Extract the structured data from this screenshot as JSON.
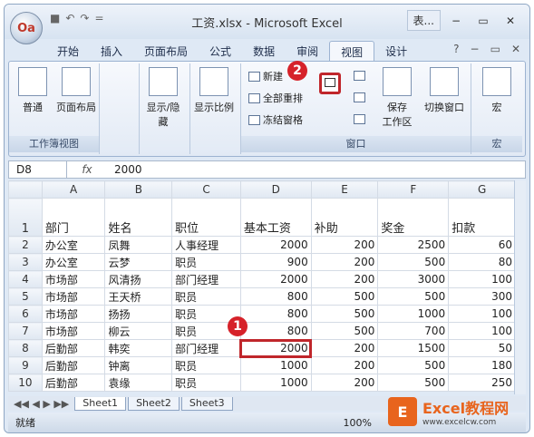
{
  "window": {
    "title": "工资.xlsx - Microsoft Excel",
    "user": "表...",
    "minimize": "−",
    "restore": "▭",
    "close": "✕"
  },
  "office_button": {
    "label": "Oa"
  },
  "quick_access": {
    "save": "■",
    "undo": "↶",
    "redo": "↷",
    "customize": "="
  },
  "tabs": [
    "开始",
    "插入",
    "页面布局",
    "公式",
    "数据",
    "审阅",
    "视图",
    "设计"
  ],
  "active_tab": "视图",
  "tabs_right": {
    "help": "?",
    "minimize": "−",
    "restore": "▭",
    "close": "✕"
  },
  "ribbon": {
    "group_workbook_views": {
      "label": "工作簿视图",
      "normal": "普通",
      "page_layout": "页面布局"
    },
    "show_hide": {
      "label": "显示/隐藏"
    },
    "zoom": {
      "label": "显示比例"
    },
    "window_group": {
      "label": "窗口",
      "new_window": "新建",
      "arrange_all": "全部重排",
      "freeze_panes": "冻结窗格",
      "save_workspace": "保存",
      "save_workspace_2": "工作区",
      "switch_windows": "切换窗口"
    },
    "macros": {
      "label": "宏",
      "button": "宏"
    }
  },
  "callouts": {
    "one": "1",
    "two": "2"
  },
  "formula_bar": {
    "name_box": "D8",
    "fx": "fx",
    "value": "2000"
  },
  "columns": [
    "A",
    "B",
    "C",
    "D",
    "E",
    "F",
    "G"
  ],
  "header_row": {
    "row": "1",
    "cells": [
      "部门",
      "姓名",
      "职位",
      "基本工资",
      "补助",
      "奖金",
      "扣款"
    ]
  },
  "rows": [
    {
      "row": "2",
      "cells": [
        "办公室",
        "凤舞",
        "人事经理",
        "2000",
        "200",
        "2500",
        "60"
      ]
    },
    {
      "row": "3",
      "cells": [
        "办公室",
        "云梦",
        "职员",
        "900",
        "200",
        "500",
        "80"
      ]
    },
    {
      "row": "4",
      "cells": [
        "市场部",
        "风清扬",
        "部门经理",
        "2000",
        "200",
        "3000",
        "100"
      ]
    },
    {
      "row": "5",
      "cells": [
        "市场部",
        "王天桥",
        "职员",
        "800",
        "500",
        "500",
        "300"
      ]
    },
    {
      "row": "6",
      "cells": [
        "市场部",
        "扬扬",
        "职员",
        "800",
        "500",
        "1000",
        "100"
      ]
    },
    {
      "row": "7",
      "cells": [
        "市场部",
        "柳云",
        "职员",
        "800",
        "500",
        "700",
        "100"
      ]
    },
    {
      "row": "8",
      "cells": [
        "后勤部",
        "韩奕",
        "部门经理",
        "2000",
        "200",
        "1500",
        "50"
      ]
    },
    {
      "row": "9",
      "cells": [
        "后勤部",
        "钟离",
        "职员",
        "1000",
        "200",
        "500",
        "180"
      ]
    },
    {
      "row": "10",
      "cells": [
        "后勤部",
        "袁缘",
        "职员",
        "1000",
        "200",
        "500",
        "250"
      ]
    }
  ],
  "sheets": [
    "Sheet1",
    "Sheet2",
    "Sheet3"
  ],
  "status": {
    "ready": "就绪",
    "zoom": "100%"
  },
  "watermark": {
    "brand": "Excel教程网",
    "url": "www.excelcw.com",
    "icon": "E"
  }
}
